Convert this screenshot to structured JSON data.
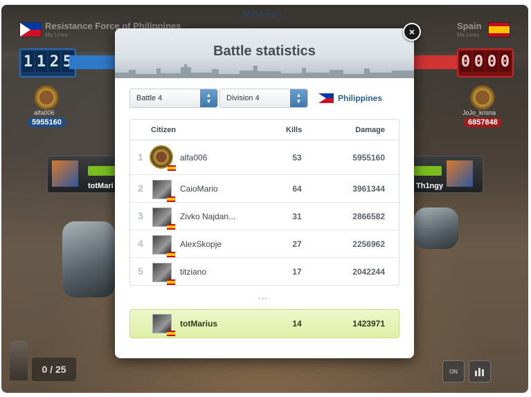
{
  "header": {
    "left_country": "Resistance Force of Philippines",
    "left_sub": "Ma Lines",
    "region": "Mindanao",
    "right_country": "Spain",
    "right_sub": "Ma Lines",
    "left_score_digits": [
      "1",
      "1",
      "2",
      "5"
    ],
    "right_score_digits": [
      "0",
      "0",
      "0",
      "0"
    ]
  },
  "heroes": {
    "left": {
      "name": "alfa006",
      "damage": "5955160"
    },
    "right": {
      "name": "JoJo_krisna",
      "damage": "6857848"
    }
  },
  "side_cards": {
    "left_name": "totMari",
    "right_name": "Th1ngy"
  },
  "footer": {
    "progress": "0 / 25",
    "toggle_label": "ON"
  },
  "modal": {
    "title": "Battle statistics",
    "close": "×",
    "battle_select": "Battle 4",
    "division_select": "Division 4",
    "country": "Philippines",
    "columns": {
      "citizen": "Citizen",
      "kills": "Kills",
      "damage": "Damage"
    },
    "rows": [
      {
        "rank": "1",
        "name": "alfa006",
        "kills": "53",
        "damage": "5955160"
      },
      {
        "rank": "2",
        "name": "CaioMario",
        "kills": "64",
        "damage": "3961344"
      },
      {
        "rank": "3",
        "name": "Zivko Najdan...",
        "kills": "31",
        "damage": "2866582"
      },
      {
        "rank": "4",
        "name": "AlexSkopje",
        "kills": "27",
        "damage": "2256962"
      },
      {
        "rank": "5",
        "name": "titziano",
        "kills": "17",
        "damage": "2042244"
      }
    ],
    "ellipsis": "•••",
    "me": {
      "name": "totMarius",
      "kills": "14",
      "damage": "1423971"
    }
  },
  "colors": {
    "accent_blue": "#2f79c9",
    "accent_red": "#d23434",
    "highlight": "#e7f3b8"
  }
}
